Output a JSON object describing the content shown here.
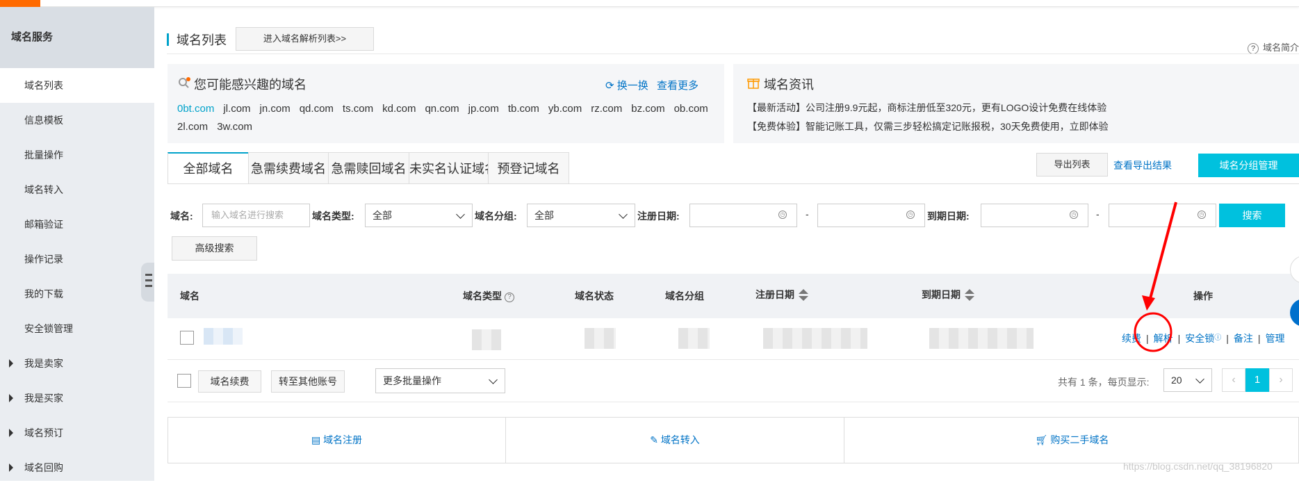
{
  "sidebar": {
    "title": "域名服务",
    "items": [
      {
        "label": "域名列表"
      },
      {
        "label": "信息模板"
      },
      {
        "label": "批量操作"
      },
      {
        "label": "域名转入"
      },
      {
        "label": "邮箱验证"
      },
      {
        "label": "操作记录"
      },
      {
        "label": "我的下载"
      },
      {
        "label": "安全锁管理"
      },
      {
        "label": "我是卖家"
      },
      {
        "label": "我是买家"
      },
      {
        "label": "域名预订"
      },
      {
        "label": "域名回购"
      }
    ]
  },
  "header": {
    "title": "域名列表",
    "enter_dns_button": "进入域名解析列表>>",
    "help_text": "域名简介"
  },
  "interest": {
    "title": "您可能感兴趣的域名",
    "refresh": "换一换",
    "more": "查看更多",
    "domains": [
      "0bt.com",
      "jl.com",
      "jn.com",
      "qd.com",
      "ts.com",
      "kd.com",
      "qn.com",
      "jp.com",
      "tb.com",
      "yb.com",
      "rz.com",
      "bz.com",
      "ob.com",
      "2l.com",
      "3w.com"
    ]
  },
  "news": {
    "title": "域名资讯",
    "lines": [
      "【最新活动】公司注册9.9元起，商标注册低至320元，更有LOGO设计免费在线体验",
      "【免费体验】智能记账工具，仅需三步轻松搞定记账报税，30天免费使用，立即体验"
    ]
  },
  "tabs": [
    "全部域名",
    "急需续费域名",
    "急需赎回域名",
    "未实名认证域名",
    "预登记域名"
  ],
  "toolbar": {
    "export_list": "导出列表",
    "view_export": "查看导出结果",
    "group_manage": "域名分组管理"
  },
  "filters": {
    "domain_label": "域名:",
    "domain_placeholder": "输入域名进行搜索",
    "type_label": "域名类型:",
    "type_value": "全部",
    "group_label": "域名分组:",
    "group_value": "全部",
    "reg_date_label": "注册日期:",
    "exp_date_label": "到期日期:",
    "dash": "-",
    "search_button": "搜索",
    "advanced_button": "高级搜索"
  },
  "table": {
    "headers": [
      "域名",
      "域名类型",
      "域名状态",
      "域名分组",
      "注册日期",
      "到期日期",
      "操作"
    ],
    "ops": [
      "续费",
      "解析",
      "安全锁",
      "备注",
      "管理"
    ]
  },
  "footer": {
    "renew_button": "域名续费",
    "transfer_button": "转至其他账号",
    "batch_select": "更多批量操作",
    "summary": "共有 1 条，每页显示:",
    "page_size": "20",
    "prev": "‹",
    "page": "1",
    "next": "›"
  },
  "bottom_links": [
    "域名注册",
    "域名转入",
    "购买二手域名"
  ],
  "watermark": "https://blog.csdn.net/qq_38196820",
  "colors": {
    "accent": "#00c1de",
    "link": "#0073c6",
    "annotation": "#ff0000",
    "brand": "#ff6a00"
  }
}
